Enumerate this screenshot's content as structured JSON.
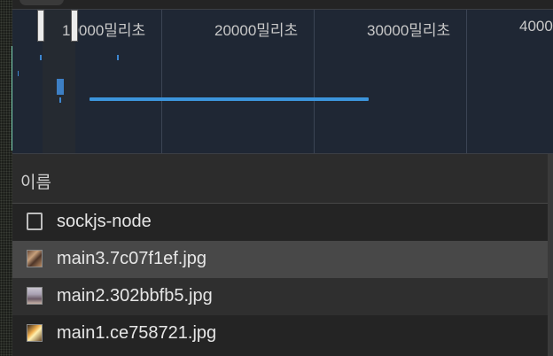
{
  "timeline": {
    "ticks": [
      "10000밀리초",
      "20000밀리초",
      "30000밀리초",
      "4000"
    ]
  },
  "list": {
    "header": "이름",
    "rows": [
      {
        "name": "sockjs-node",
        "icon": "document-icon"
      },
      {
        "name": "main3.7c07f1ef.jpg",
        "icon": "image-thumbnail-icon"
      },
      {
        "name": "main2.302bbfb5.jpg",
        "icon": "image-thumbnail-icon"
      },
      {
        "name": "main1.ce758721.jpg",
        "icon": "image-thumbnail-icon"
      }
    ],
    "selected_row": 1
  },
  "colors": {
    "timeline_bg": "#1f2734",
    "row_bg_dark": "#242424",
    "row_bg_light": "#2f2f2f",
    "row_selected": "#484848",
    "request_bar": "#3c95dc"
  }
}
